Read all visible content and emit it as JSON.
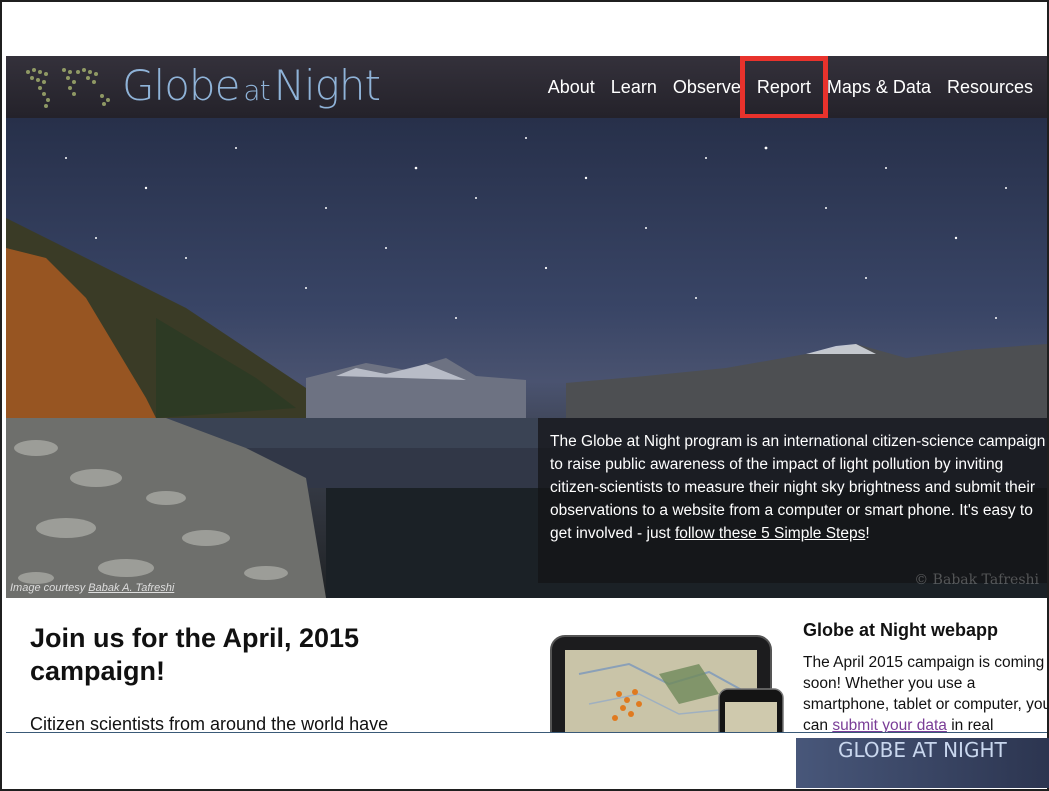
{
  "site": {
    "logo_word_1": "Globe",
    "logo_word_2": "at",
    "logo_word_3": "Night"
  },
  "nav": {
    "items": [
      {
        "label": "About"
      },
      {
        "label": "Learn"
      },
      {
        "label": "Observe"
      },
      {
        "label": "Report"
      },
      {
        "label": "Maps & Data"
      },
      {
        "label": "Resources"
      }
    ],
    "highlighted": "Report",
    "highlight_color": "#e8322c"
  },
  "hero": {
    "caption_text": "The Globe at Night program is an international citizen-science campaign to raise public awareness of the impact of light pollution by inviting citizen-scientists to measure their night sky brightness and submit their observations to a website from a computer or smart phone. It's easy to get involved - just ",
    "caption_link": "follow these 5 Simple Steps",
    "caption_end": "!",
    "credit_prefix": "Image courtesy ",
    "credit_link": "Babak A. Tafreshi",
    "watermark": "© Babak Tafreshi"
  },
  "main": {
    "join_title": "Join us for the April, 2015 campaign!",
    "join_body": "Citizen scientists from around the world have"
  },
  "webapp": {
    "title": "Globe at Night webapp",
    "body_text": "The April 2015 campaign is coming soon! Whether you use a smartphone, tablet or computer, you can ",
    "body_link": "submit your data",
    "body_end": " in real"
  },
  "footer": {
    "logo_text": "GLOBE AT NIGHT"
  }
}
